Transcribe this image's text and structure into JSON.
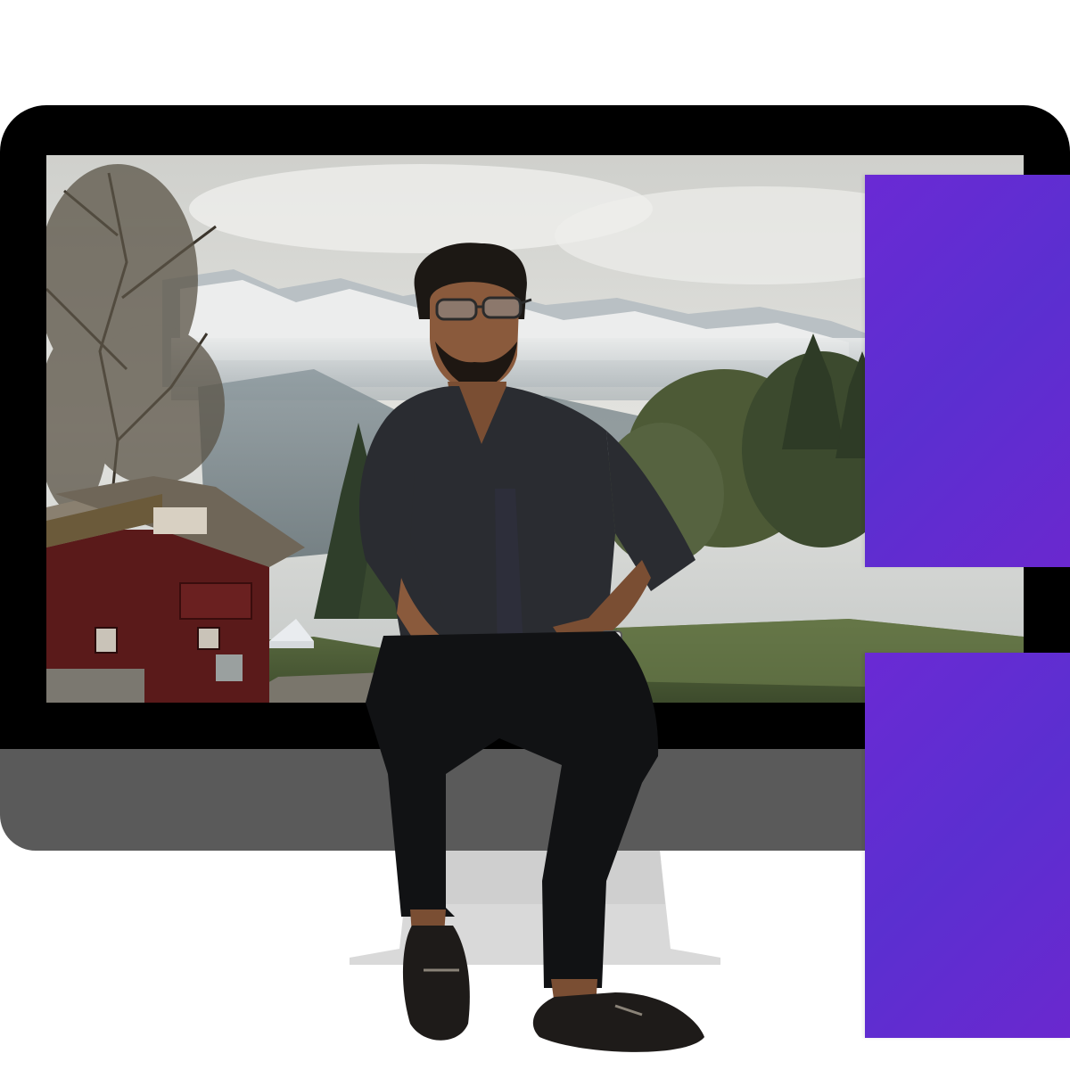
{
  "scene": {
    "subject": "person-seated",
    "colors": {
      "bezel": "#000000",
      "chin": "#5a5a5a",
      "stand": "#d9d9d9",
      "accent_panel": "#5b2fd0",
      "sky": "#d9d9d4",
      "grass": "#4d5f38",
      "house_wall": "#5a1a1a",
      "shirt": "#2a2c31",
      "pants": "#111214",
      "skin": "#8a5a3c"
    },
    "icons": {
      "monitor": "desktop-monitor-icon"
    }
  }
}
